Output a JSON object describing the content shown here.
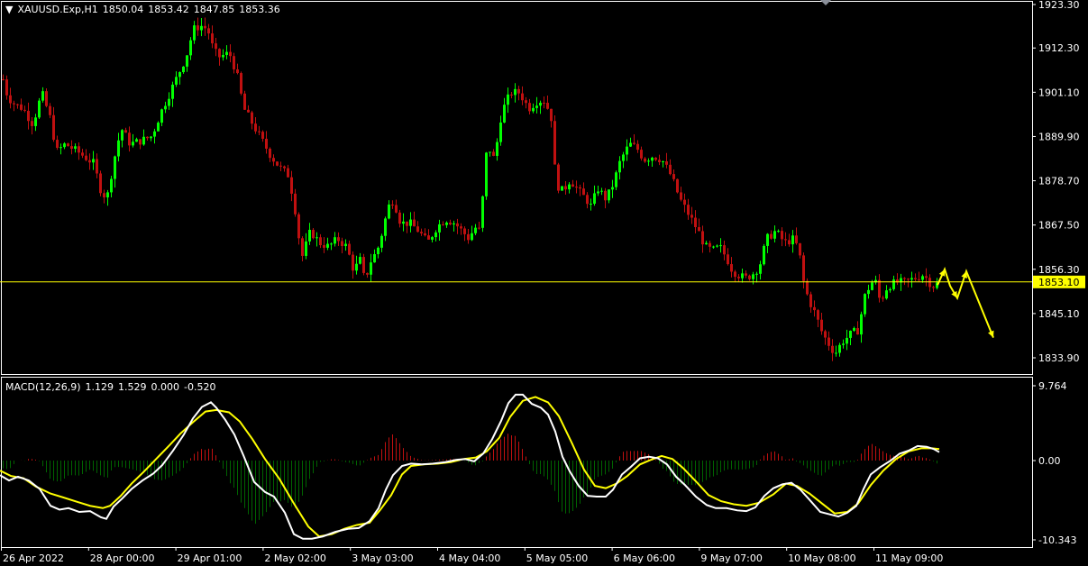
{
  "header": {
    "symbol": "XAUUSD.Exp,H1",
    "open": "1850.04",
    "high": "1853.42",
    "low": "1847.85",
    "close": "1853.36"
  },
  "macd_header": {
    "name": "MACD(12,26,9)",
    "main": "1.129",
    "signal": "1.529",
    "v3": "0.000",
    "v4": "-0.520"
  },
  "colors": {
    "background": "#000000",
    "bull": "#00ff00",
    "bear": "#c01010",
    "price_line": "#ffff00",
    "macd_main": "#ffffff",
    "macd_signal": "#ffff00",
    "hist_pos": "#c01010",
    "hist_neg": "#006400",
    "grid_text": "#ffffff"
  },
  "chart_data": [
    {
      "type": "candlestick",
      "title": "XAUUSD.Exp,H1",
      "y_ticks": [
        "1923.30",
        "1912.30",
        "1901.10",
        "1889.90",
        "1878.70",
        "1867.50",
        "1856.30",
        "1845.10",
        "1833.90"
      ],
      "ylim": [
        1830.6,
        1923.3
      ],
      "current_price": "1853.10",
      "x_labels": [
        "26 Apr 2022",
        "28 Apr 00:00",
        "29 Apr 01:00",
        "2 May 02:00",
        "3 May 03:00",
        "4 May 04:00",
        "5 May 05:00",
        "6 May 06:00",
        "9 May 07:00",
        "10 May 08:00",
        "11 May 09:00"
      ],
      "close_path": [
        [
          0,
          1907
        ],
        [
          8,
          1900
        ],
        [
          16,
          1898
        ],
        [
          25,
          1897
        ],
        [
          36,
          1893
        ],
        [
          46,
          1901
        ],
        [
          56,
          1894
        ],
        [
          62,
          1886
        ],
        [
          72,
          1888
        ],
        [
          86,
          1886
        ],
        [
          104,
          1883
        ],
        [
          110,
          1877
        ],
        [
          118,
          1874
        ],
        [
          126,
          1884
        ],
        [
          134,
          1892
        ],
        [
          144,
          1888
        ],
        [
          158,
          1889
        ],
        [
          168,
          1890
        ],
        [
          178,
          1896
        ],
        [
          188,
          1901
        ],
        [
          198,
          1906
        ],
        [
          206,
          1910
        ],
        [
          214,
          1917
        ],
        [
          222,
          1918
        ],
        [
          230,
          1917
        ],
        [
          236,
          1912
        ],
        [
          242,
          1910
        ],
        [
          254,
          1911
        ],
        [
          262,
          1906
        ],
        [
          270,
          1897
        ],
        [
          280,
          1893
        ],
        [
          290,
          1889
        ],
        [
          300,
          1885
        ],
        [
          310,
          1882
        ],
        [
          320,
          1880
        ],
        [
          328,
          1870
        ],
        [
          334,
          1859
        ],
        [
          344,
          1866
        ],
        [
          354,
          1863
        ],
        [
          364,
          1862
        ],
        [
          374,
          1864
        ],
        [
          384,
          1862
        ],
        [
          392,
          1856
        ],
        [
          400,
          1859
        ],
        [
          404,
          1853
        ],
        [
          410,
          1858
        ],
        [
          418,
          1861
        ],
        [
          424,
          1866
        ],
        [
          430,
          1872
        ],
        [
          436,
          1874
        ],
        [
          444,
          1868
        ],
        [
          454,
          1868
        ],
        [
          464,
          1866
        ],
        [
          474,
          1863
        ],
        [
          484,
          1867
        ],
        [
          494,
          1869
        ],
        [
          504,
          1868
        ],
        [
          512,
          1866
        ],
        [
          520,
          1864
        ],
        [
          526,
          1867
        ],
        [
          532,
          1866
        ],
        [
          540,
          1888
        ],
        [
          548,
          1884
        ],
        [
          556,
          1896
        ],
        [
          566,
          1901
        ],
        [
          576,
          1901
        ],
        [
          586,
          1897
        ],
        [
          596,
          1899
        ],
        [
          604,
          1899
        ],
        [
          612,
          1894
        ],
        [
          616,
          1878
        ],
        [
          624,
          1876
        ],
        [
          632,
          1879
        ],
        [
          642,
          1876
        ],
        [
          650,
          1874
        ],
        [
          656,
          1872
        ],
        [
          662,
          1877
        ],
        [
          672,
          1874
        ],
        [
          680,
          1878
        ],
        [
          688,
          1884
        ],
        [
          698,
          1888
        ],
        [
          706,
          1887
        ],
        [
          714,
          1884
        ],
        [
          724,
          1885
        ],
        [
          734,
          1884
        ],
        [
          744,
          1880
        ],
        [
          754,
          1874
        ],
        [
          764,
          1870
        ],
        [
          774,
          1866
        ],
        [
          782,
          1862
        ],
        [
          790,
          1861
        ],
        [
          798,
          1862
        ],
        [
          806,
          1859
        ],
        [
          812,
          1856
        ],
        [
          818,
          1855
        ],
        [
          826,
          1854
        ],
        [
          834,
          1855
        ],
        [
          842,
          1857
        ],
        [
          850,
          1864
        ],
        [
          860,
          1866
        ],
        [
          870,
          1863
        ],
        [
          880,
          1864
        ],
        [
          886,
          1861
        ],
        [
          890,
          1854
        ],
        [
          896,
          1849
        ],
        [
          904,
          1845
        ],
        [
          912,
          1840
        ],
        [
          920,
          1837
        ],
        [
          926,
          1835
        ],
        [
          934,
          1838
        ],
        [
          944,
          1840
        ],
        [
          952,
          1841
        ],
        [
          958,
          1849
        ],
        [
          964,
          1852
        ],
        [
          970,
          1854
        ],
        [
          976,
          1848
        ],
        [
          984,
          1852
        ],
        [
          994,
          1853
        ],
        [
          1004,
          1853
        ],
        [
          1014,
          1854
        ],
        [
          1024,
          1855
        ],
        [
          1034,
          1852
        ],
        [
          1042,
          1853
        ]
      ],
      "forecast_arrows": [
        [
          [
            1040,
            1852.3
          ],
          [
            1048,
            1856.3
          ],
          [
            1054,
            1852.1
          ],
          [
            1062,
            1849.0
          ],
          [
            1072,
            1855.8
          ],
          [
            1102,
            1839.0
          ]
        ]
      ]
    },
    {
      "type": "macd",
      "title": "MACD(12,26,9)",
      "y_ticks": [
        "9.764",
        "0.00",
        "-10.343"
      ],
      "ylim": [
        -10.343,
        9.764
      ],
      "main": [
        [
          0,
          -1.9
        ],
        [
          10,
          -2.6
        ],
        [
          20,
          -2.1
        ],
        [
          32,
          -2.6
        ],
        [
          44,
          -3.7
        ],
        [
          56,
          -5.9
        ],
        [
          66,
          -6.4
        ],
        [
          76,
          -6.2
        ],
        [
          88,
          -6.7
        ],
        [
          100,
          -6.6
        ],
        [
          112,
          -7.4
        ],
        [
          118,
          -7.6
        ],
        [
          126,
          -6.0
        ],
        [
          136,
          -4.9
        ],
        [
          146,
          -3.7
        ],
        [
          158,
          -2.6
        ],
        [
          170,
          -1.7
        ],
        [
          180,
          -0.6
        ],
        [
          192,
          1.3
        ],
        [
          204,
          3.4
        ],
        [
          214,
          5.5
        ],
        [
          224,
          7.0
        ],
        [
          234,
          7.6
        ],
        [
          240,
          6.9
        ],
        [
          250,
          5.3
        ],
        [
          260,
          3.4
        ],
        [
          270,
          0.7
        ],
        [
          282,
          -2.8
        ],
        [
          294,
          -4.1
        ],
        [
          304,
          -4.7
        ],
        [
          316,
          -6.8
        ],
        [
          326,
          -9.6
        ],
        [
          336,
          -10.2
        ],
        [
          346,
          -10.2
        ],
        [
          358,
          -9.9
        ],
        [
          372,
          -9.3
        ],
        [
          386,
          -8.9
        ],
        [
          398,
          -8.8
        ],
        [
          410,
          -7.9
        ],
        [
          420,
          -6.2
        ],
        [
          428,
          -3.8
        ],
        [
          436,
          -1.9
        ],
        [
          446,
          -0.7
        ],
        [
          456,
          -0.4
        ],
        [
          468,
          -0.5
        ],
        [
          480,
          -0.4
        ],
        [
          494,
          -0.2
        ],
        [
          506,
          0.1
        ],
        [
          516,
          0.2
        ],
        [
          526,
          -0.1
        ],
        [
          536,
          0.9
        ],
        [
          546,
          2.8
        ],
        [
          556,
          5.2
        ],
        [
          564,
          7.5
        ],
        [
          572,
          8.6
        ],
        [
          580,
          8.6
        ],
        [
          590,
          7.4
        ],
        [
          600,
          6.9
        ],
        [
          608,
          6.0
        ],
        [
          616,
          3.8
        ],
        [
          624,
          0.5
        ],
        [
          632,
          -1.4
        ],
        [
          642,
          -3.3
        ],
        [
          652,
          -4.6
        ],
        [
          662,
          -4.7
        ],
        [
          672,
          -4.7
        ],
        [
          680,
          -3.8
        ],
        [
          690,
          -1.8
        ],
        [
          700,
          -0.8
        ],
        [
          710,
          0.3
        ],
        [
          720,
          0.5
        ],
        [
          730,
          0.3
        ],
        [
          740,
          -0.5
        ],
        [
          750,
          -2.1
        ],
        [
          760,
          -3.2
        ],
        [
          772,
          -4.7
        ],
        [
          784,
          -5.8
        ],
        [
          794,
          -6.2
        ],
        [
          806,
          -6.2
        ],
        [
          818,
          -6.5
        ],
        [
          828,
          -6.6
        ],
        [
          838,
          -6.1
        ],
        [
          848,
          -4.6
        ],
        [
          858,
          -3.6
        ],
        [
          868,
          -3.1
        ],
        [
          878,
          -2.9
        ],
        [
          888,
          -3.8
        ],
        [
          898,
          -5.1
        ],
        [
          910,
          -6.7
        ],
        [
          920,
          -7.0
        ],
        [
          930,
          -7.3
        ],
        [
          940,
          -6.8
        ],
        [
          950,
          -5.9
        ],
        [
          958,
          -3.7
        ],
        [
          966,
          -1.8
        ],
        [
          976,
          -0.9
        ],
        [
          988,
          0.0
        ],
        [
          998,
          0.9
        ],
        [
          1008,
          1.3
        ],
        [
          1018,
          1.9
        ],
        [
          1028,
          1.8
        ],
        [
          1036,
          1.5
        ],
        [
          1042,
          1.1
        ]
      ],
      "signal": [
        [
          0,
          -1.3
        ],
        [
          12,
          -2.0
        ],
        [
          26,
          -2.3
        ],
        [
          40,
          -3.4
        ],
        [
          56,
          -4.3
        ],
        [
          70,
          -4.8
        ],
        [
          86,
          -5.4
        ],
        [
          100,
          -5.9
        ],
        [
          114,
          -6.2
        ],
        [
          122,
          -5.9
        ],
        [
          134,
          -4.6
        ],
        [
          146,
          -3.0
        ],
        [
          160,
          -1.4
        ],
        [
          174,
          0.3
        ],
        [
          188,
          2.0
        ],
        [
          200,
          3.5
        ],
        [
          214,
          5.0
        ],
        [
          228,
          6.4
        ],
        [
          240,
          6.6
        ],
        [
          254,
          6.3
        ],
        [
          266,
          5.1
        ],
        [
          280,
          2.8
        ],
        [
          294,
          0.2
        ],
        [
          310,
          -2.4
        ],
        [
          326,
          -5.6
        ],
        [
          342,
          -8.6
        ],
        [
          354,
          -9.9
        ],
        [
          368,
          -9.6
        ],
        [
          382,
          -8.9
        ],
        [
          396,
          -8.4
        ],
        [
          410,
          -8.1
        ],
        [
          422,
          -6.4
        ],
        [
          434,
          -4.5
        ],
        [
          446,
          -1.8
        ],
        [
          456,
          -0.7
        ],
        [
          470,
          -0.5
        ],
        [
          486,
          -0.4
        ],
        [
          500,
          -0.2
        ],
        [
          514,
          0.2
        ],
        [
          528,
          0.4
        ],
        [
          540,
          1.2
        ],
        [
          554,
          3.0
        ],
        [
          566,
          5.7
        ],
        [
          580,
          7.8
        ],
        [
          594,
          8.3
        ],
        [
          608,
          7.6
        ],
        [
          620,
          5.8
        ],
        [
          634,
          2.4
        ],
        [
          648,
          -1.2
        ],
        [
          660,
          -3.3
        ],
        [
          672,
          -3.6
        ],
        [
          684,
          -3.0
        ],
        [
          696,
          -2.0
        ],
        [
          710,
          -0.5
        ],
        [
          722,
          0.1
        ],
        [
          734,
          0.6
        ],
        [
          746,
          0.2
        ],
        [
          758,
          -1.0
        ],
        [
          772,
          -2.7
        ],
        [
          786,
          -4.5
        ],
        [
          800,
          -5.3
        ],
        [
          814,
          -5.7
        ],
        [
          828,
          -5.9
        ],
        [
          842,
          -5.5
        ],
        [
          858,
          -4.4
        ],
        [
          872,
          -3.0
        ],
        [
          884,
          -3.3
        ],
        [
          898,
          -4.3
        ],
        [
          912,
          -5.6
        ],
        [
          926,
          -6.9
        ],
        [
          940,
          -6.7
        ],
        [
          952,
          -5.6
        ],
        [
          966,
          -3.2
        ],
        [
          980,
          -1.3
        ],
        [
          994,
          0.2
        ],
        [
          1008,
          1.2
        ],
        [
          1022,
          1.6
        ],
        [
          1034,
          1.6
        ],
        [
          1042,
          1.5
        ]
      ]
    }
  ]
}
